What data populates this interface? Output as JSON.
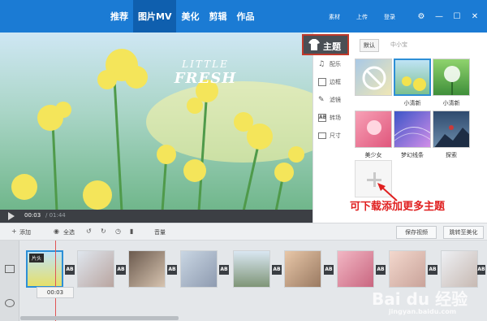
{
  "nav": {
    "tabs": [
      "推荐",
      "图片MV",
      "美化",
      "剪辑",
      "作品"
    ],
    "active": 1
  },
  "top_links": [
    "素材",
    "上传",
    "登录"
  ],
  "preview": {
    "title_line1": "LITTLE",
    "title_line2": "FRESH",
    "time_current": "00:03",
    "time_total": "/ 01:44"
  },
  "side_menu": {
    "theme": "主题",
    "items": [
      "配乐",
      "边框",
      "滤镜",
      "转场",
      "尺寸"
    ]
  },
  "grid": {
    "tabs": [
      "默认",
      "中小宝"
    ],
    "thumbs": [
      {
        "caption": ""
      },
      {
        "caption": "小清新"
      },
      {
        "caption": "小清新"
      },
      {
        "caption": "美少女"
      },
      {
        "caption": "梦幻线条"
      },
      {
        "caption": "探索"
      }
    ],
    "annotation": "可下载添加更多主题"
  },
  "toolbar": {
    "add": "添加",
    "all": "全选",
    "volume": "音量",
    "save": "保存视频",
    "jump": "跳转至美化"
  },
  "timeline": {
    "clip_head": "片头",
    "clip_time": "00:03",
    "trans_label": "AB"
  },
  "watermark": {
    "main": "Bai du 经验",
    "sub": "jingyan.baidu.com"
  }
}
